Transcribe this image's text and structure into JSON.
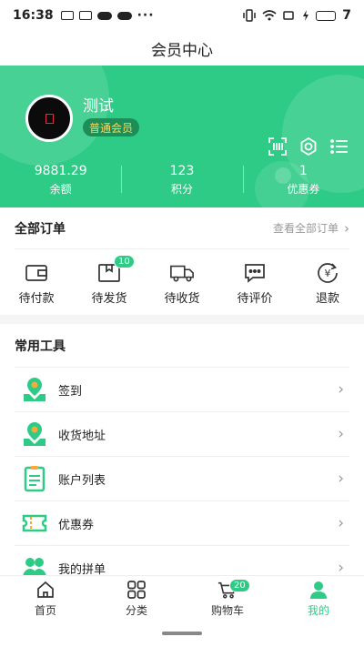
{
  "status_bar": {
    "time": "16:38",
    "battery": "7"
  },
  "title": "会员中心",
  "profile": {
    "username": "测试",
    "level": "普通会员"
  },
  "stats": [
    {
      "value": "9881.29",
      "label": "余额"
    },
    {
      "value": "123",
      "label": "积分"
    },
    {
      "value": "1",
      "label": "优惠券"
    }
  ],
  "orders": {
    "title": "全部订单",
    "view_all": "查看全部订单",
    "items": [
      {
        "label": "待付款",
        "icon": "wallet-icon",
        "badge": ""
      },
      {
        "label": "待发货",
        "icon": "package-icon",
        "badge": "10"
      },
      {
        "label": "待收货",
        "icon": "truck-icon",
        "badge": ""
      },
      {
        "label": "待评价",
        "icon": "comment-icon",
        "badge": ""
      },
      {
        "label": "退款",
        "icon": "refund-icon",
        "badge": ""
      }
    ]
  },
  "tools": {
    "title": "常用工具",
    "items": [
      {
        "label": "签到",
        "icon": "checkin-icon"
      },
      {
        "label": "收货地址",
        "icon": "location-icon"
      },
      {
        "label": "账户列表",
        "icon": "list-doc-icon"
      },
      {
        "label": "优惠券",
        "icon": "coupon-icon"
      },
      {
        "label": "我的拼单",
        "icon": "group-icon"
      }
    ]
  },
  "tabbar": [
    {
      "label": "首页",
      "icon": "home-icon",
      "badge": ""
    },
    {
      "label": "分类",
      "icon": "category-icon",
      "badge": ""
    },
    {
      "label": "购物车",
      "icon": "cart-icon",
      "badge": "20"
    },
    {
      "label": "我的",
      "icon": "user-icon",
      "badge": "",
      "active": true
    }
  ],
  "colors": {
    "accent": "#2ecb86",
    "badge_text": "#ffd45c"
  }
}
